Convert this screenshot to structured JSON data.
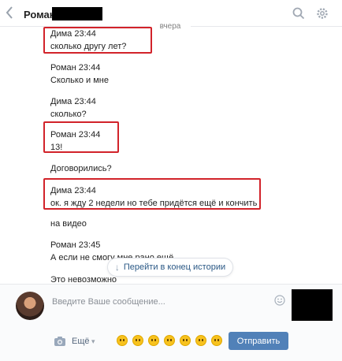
{
  "header": {
    "back_icon": "chevron-left-icon",
    "contact_name": "Роман",
    "search_icon": "search-icon",
    "settings_icon": "gear-icon"
  },
  "date_separator": "вчера",
  "messages": [
    {
      "author_time": "Дима 23:44",
      "text": "сколько другу лет?"
    },
    {
      "author_time": "Роман 23:44",
      "text": "Сколько и мне"
    },
    {
      "author_time": "Дима 23:44",
      "text": "сколько?"
    },
    {
      "author_time": "Роман 23:44",
      "text": "13!"
    },
    {
      "author_time": "",
      "text": "Договорились?"
    },
    {
      "author_time": "Дима 23:44",
      "text": "ок. я жду 2 недели но тебе придётся ещё и кончить"
    },
    {
      "author_time": "",
      "text": "на видео"
    },
    {
      "author_time": "Роман 23:45",
      "text": "А если не смогу мне рано ещё"
    },
    {
      "author_time": "",
      "text": "Это невозможно"
    }
  ],
  "jump_button": {
    "label": "Перейти в конец истории",
    "icon": "arrow-down-icon"
  },
  "composer": {
    "placeholder": "Введите Ваше сообщение...",
    "more_label": "Ещё",
    "send_label": "Отправить",
    "emoji_count": 7
  },
  "colors": {
    "accent": "#5181b8",
    "highlight_border": "#d2232a",
    "link": "#2a5885"
  }
}
